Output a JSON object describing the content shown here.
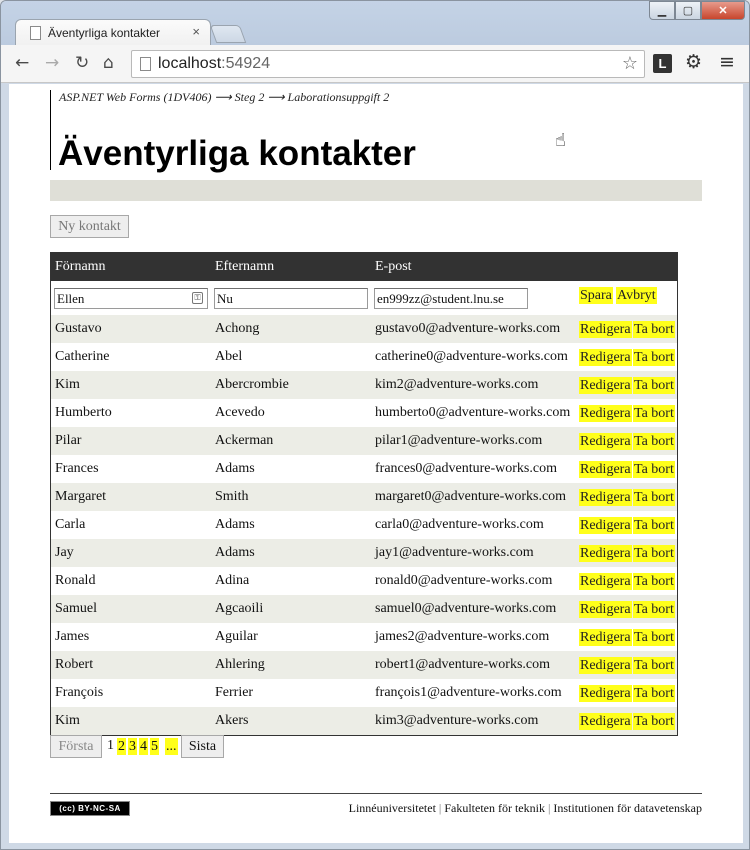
{
  "browser": {
    "tab_title": "Äventyrliga kontakter",
    "tab_close": "×",
    "url_host": "localhost",
    "url_port": ":54924",
    "window_buttons": {
      "minimize": "▁",
      "maximize": "▢",
      "close": "✕"
    },
    "extension_label": "L"
  },
  "page": {
    "breadcrumb": "ASP.NET Web Forms (1DV406) ⟶ Steg 2 ⟶ Laborationsuppgift 2",
    "title": "Äventyrliga kontakter",
    "new_contact_button": "Ny kontakt"
  },
  "grid": {
    "headers": [
      "Förnamn",
      "Efternamn",
      "E-post"
    ],
    "edit_row": {
      "first_name": "Ellen",
      "last_name": "Nu",
      "email": "en999zz@student.lnu.se",
      "save_label": "Spara",
      "cancel_label": "Avbryt"
    },
    "edit_label": "Redigera",
    "delete_label": "Ta bort",
    "rows": [
      {
        "first": "Gustavo",
        "last": "Achong",
        "email": "gustavo0@adventure-works.com"
      },
      {
        "first": "Catherine",
        "last": "Abel",
        "email": "catherine0@adventure-works.com"
      },
      {
        "first": "Kim",
        "last": "Abercrombie",
        "email": "kim2@adventure-works.com"
      },
      {
        "first": "Humberto",
        "last": "Acevedo",
        "email": "humberto0@adventure-works.com"
      },
      {
        "first": "Pilar",
        "last": "Ackerman",
        "email": "pilar1@adventure-works.com"
      },
      {
        "first": "Frances",
        "last": "Adams",
        "email": "frances0@adventure-works.com"
      },
      {
        "first": "Margaret",
        "last": "Smith",
        "email": "margaret0@adventure-works.com"
      },
      {
        "first": "Carla",
        "last": "Adams",
        "email": "carla0@adventure-works.com"
      },
      {
        "first": "Jay",
        "last": "Adams",
        "email": "jay1@adventure-works.com"
      },
      {
        "first": "Ronald",
        "last": "Adina",
        "email": "ronald0@adventure-works.com"
      },
      {
        "first": "Samuel",
        "last": "Agcaoili",
        "email": "samuel0@adventure-works.com"
      },
      {
        "first": "James",
        "last": "Aguilar",
        "email": "james2@adventure-works.com"
      },
      {
        "first": "Robert",
        "last": "Ahlering",
        "email": "robert1@adventure-works.com"
      },
      {
        "first": "François",
        "last": "Ferrier",
        "email": "françois1@adventure-works.com"
      },
      {
        "first": "Kim",
        "last": "Akers",
        "email": "kim3@adventure-works.com"
      }
    ]
  },
  "pager": {
    "first_label": "Första",
    "current_page": "1",
    "pages": [
      "2",
      "3",
      "4",
      "5"
    ],
    "more_label": "...",
    "last_label": "Sista"
  },
  "footer": {
    "license_badge": "(cc) BY-NC-SA",
    "links": [
      "Linnéuniversitetet",
      "Fakulteten för teknik",
      "Institutionen för datavetenskap"
    ],
    "separator": "|"
  }
}
